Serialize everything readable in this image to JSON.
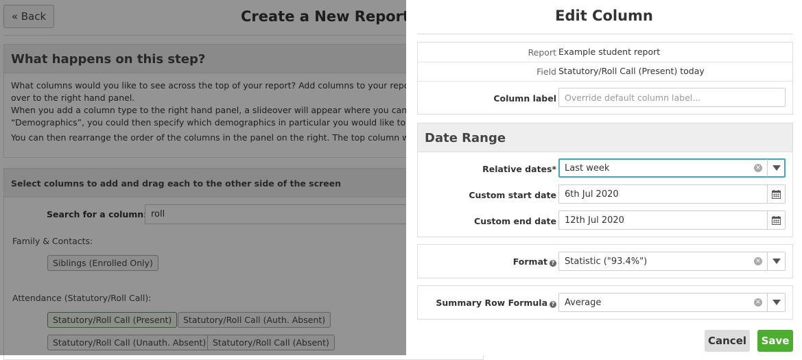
{
  "background": {
    "back_label": "« Back",
    "page_title": "Create a New Report: Se",
    "info": {
      "heading": "What happens on this step?",
      "lines": [
        "What columns would you like to see across the top of your report? Add columns to your report by",
        "over to the right hand panel.",
        "When you add a column type to the right hand panel, a slideover will appear where you can set s",
        "“Demographics”, you could then specify which demographics in particular you would like to see, f",
        "You can then rearrange the order of the columns in the panel on the right. The top column will b"
      ]
    },
    "columns": {
      "heading": "Select columns to add and drag each to the other side of the screen",
      "search_label": "Search for a column:",
      "search_value": "roll",
      "groups": [
        {
          "label": "Family & Contacts:",
          "chips": [
            "Siblings (Enrolled Only)"
          ]
        },
        {
          "label": "Attendance (Statutory/Roll Call):",
          "chips": [
            "Statutory/Roll Call (Present)",
            "Statutory/Roll Call (Auth. Absent)",
            "Statutory/Roll Call (Unauth. Absent)",
            "Statutory/Roll Call (Absent)"
          ]
        }
      ]
    }
  },
  "panel": {
    "title": "Edit Column",
    "details": {
      "report_label": "Report",
      "report_value": "Example student report",
      "field_label": "Field",
      "field_value": "Statutory/Roll Call (Present) today",
      "column_label_label": "Column label",
      "column_label_value": "",
      "column_label_placeholder": "Override default column label..."
    },
    "date_range": {
      "heading": "Date Range",
      "relative_label": "Relative dates*",
      "relative_value": "Last week",
      "start_label": "Custom start date",
      "start_value": "6th Jul 2020",
      "end_label": "Custom end date",
      "end_value": "12th Jul 2020"
    },
    "format": {
      "label": "Format",
      "value": "Statistic (\"93.4%\")"
    },
    "summary": {
      "label": "Summary Row Formula",
      "value": "Average"
    },
    "buttons": {
      "cancel": "Cancel",
      "save": "Save"
    },
    "icons": {
      "clear": "clear-icon",
      "dropdown": "chevron-down-icon",
      "calendar": "calendar-icon",
      "help": "help-icon"
    },
    "colors": {
      "focus": "#37a8c6",
      "save": "#4cae2e",
      "selected_chip": "#5a9e3c"
    }
  }
}
